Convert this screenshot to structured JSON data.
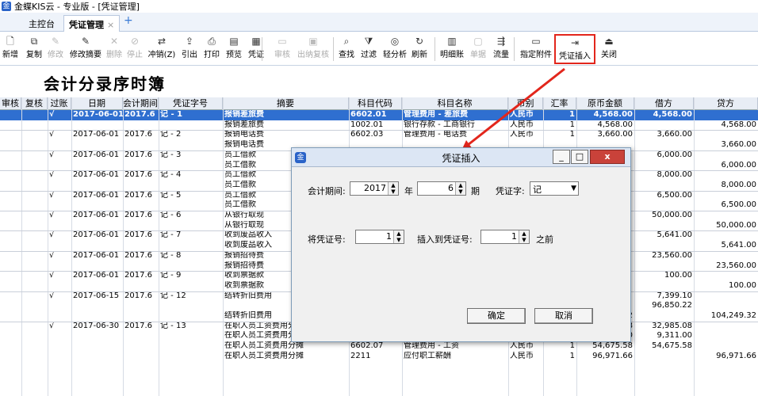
{
  "window": {
    "title": "金蝶KIS云 - 专业版 - [凭证管理]"
  },
  "tabs": [
    {
      "label": "主控台"
    },
    {
      "label": "凭证管理",
      "close": "×"
    }
  ],
  "tab_add": "+",
  "toolbar": {
    "buttons": [
      {
        "label": "新增",
        "icon": "new-icon"
      },
      {
        "label": "复制",
        "icon": "copy-icon"
      },
      {
        "label": "修改",
        "icon": "edit-icon",
        "disabled": true
      },
      {
        "label": "修改摘要",
        "icon": "edit-summary-icon"
      },
      {
        "label": "删除",
        "icon": "delete-icon",
        "disabled": true
      },
      {
        "label": "停止",
        "icon": "stop-icon",
        "disabled": true
      },
      {
        "label": "冲销(Z)",
        "icon": "reverse-icon"
      },
      {
        "label": "引出",
        "icon": "export-icon"
      },
      {
        "label": "打印",
        "icon": "print-icon"
      },
      {
        "label": "预览",
        "icon": "preview-icon"
      },
      {
        "label": "凭证",
        "icon": "voucher-icon"
      },
      {
        "label": "审核",
        "icon": "audit-icon",
        "disabled": true
      },
      {
        "label": "出纳复核",
        "icon": "cashier-review-icon",
        "disabled": true
      },
      {
        "label": "查找",
        "icon": "find-icon"
      },
      {
        "label": "过滤",
        "icon": "filter-icon"
      },
      {
        "label": "轻分析",
        "icon": "analysis-icon"
      },
      {
        "label": "刷新",
        "icon": "refresh-icon"
      },
      {
        "label": "明细账",
        "icon": "ledger-icon"
      },
      {
        "label": "单据",
        "icon": "document-icon",
        "disabled": true
      },
      {
        "label": "流量",
        "icon": "flow-icon"
      },
      {
        "label": "指定附件",
        "icon": "attachment-icon"
      },
      {
        "label": "凭证插入",
        "icon": "insert-icon"
      },
      {
        "label": "关闭",
        "icon": "close-icon"
      }
    ]
  },
  "report": {
    "title": "会计分录序时簿"
  },
  "grid": {
    "columns": [
      "审核",
      "复核",
      "过账",
      "日期",
      "会计期间",
      "凭证字号",
      "摘要",
      "科目代码",
      "科目名称",
      "币别",
      "汇率",
      "原币金额",
      "借方",
      "贷方"
    ],
    "rows": [
      {
        "sel": true,
        "posted": "√",
        "date": "2017-06-01",
        "period": "2017.6",
        "voucher": "记 - 1",
        "summary": "报销差旅费",
        "code": "6602.01",
        "account": "管理费用 - 差旅费",
        "currency": "人民币",
        "rate": "1",
        "amount": "4,568.00",
        "debit": "4,568.00",
        "credit": ""
      },
      {
        "summary": "报销差旅费",
        "code": "1002.01",
        "account": "银行存款 - 工商银行",
        "currency": "人民币",
        "rate": "1",
        "amount": "4,568.00",
        "debit": "",
        "credit": "4,568.00"
      },
      {
        "posted": "√",
        "date": "2017-06-01",
        "period": "2017.6",
        "voucher": "记 - 2",
        "summary": "报销电话费",
        "code": "6602.03",
        "account": "管理费用 - 电话费",
        "currency": "人民币",
        "rate": "1",
        "amount": "3,660.00",
        "debit": "3,660.00",
        "credit": ""
      },
      {
        "summary": "报销电话费",
        "credit": "3,660.00"
      },
      {
        "posted": "√",
        "date": "2017-06-01",
        "period": "2017.6",
        "voucher": "记 - 3",
        "summary": "员工借款",
        "debit": "6,000.00"
      },
      {
        "summary": "员工借款",
        "credit": "6,000.00"
      },
      {
        "posted": "√",
        "date": "2017-06-01",
        "period": "2017.6",
        "voucher": "记 - 4",
        "summary": "员工借款",
        "debit": "8,000.00"
      },
      {
        "summary": "员工借款",
        "credit": "8,000.00"
      },
      {
        "posted": "√",
        "date": "2017-06-01",
        "period": "2017.6",
        "voucher": "记 - 5",
        "summary": "员工借款",
        "debit": "6,500.00"
      },
      {
        "summary": "员工借款",
        "credit": "6,500.00"
      },
      {
        "posted": "√",
        "date": "2017-06-01",
        "period": "2017.6",
        "voucher": "记 - 6",
        "summary": "从银行取现",
        "debit": "50,000.00"
      },
      {
        "summary": "从银行取现",
        "credit": "50,000.00"
      },
      {
        "posted": "√",
        "date": "2017-06-01",
        "period": "2017.6",
        "voucher": "记 - 7",
        "summary": "收到废品收入",
        "debit": "5,641.00"
      },
      {
        "summary": "收到废品收入",
        "credit": "5,641.00"
      },
      {
        "posted": "√",
        "date": "2017-06-01",
        "period": "2017.6",
        "voucher": "记 - 8",
        "summary": "报销招待费",
        "debit": "23,560.00"
      },
      {
        "summary": "报销招待费",
        "credit": "23,560.00"
      },
      {
        "posted": "√",
        "date": "2017-06-01",
        "period": "2017.6",
        "voucher": "记 - 9",
        "summary": "收到票据款",
        "debit": "100.00"
      },
      {
        "summary": "收到票据款",
        "credit": "100.00"
      },
      {
        "posted": "√",
        "date": "2017-06-15",
        "period": "2017.6",
        "voucher": "记 - 12",
        "summary": "结转折旧费用",
        "debit": "7,399.10"
      },
      {
        "debit": "96,850.22"
      },
      {
        "summary": "结转折旧费用",
        "code": "1602",
        "account": "累计折旧",
        "currency": "人民币",
        "rate": "1",
        "amount": "104,249.32",
        "credit": "104,249.32"
      },
      {
        "posted": "√",
        "date": "2017-06-30",
        "period": "2017.6",
        "voucher": "记 - 13",
        "summary": "在职人员工资费用分摊",
        "code": "6401",
        "account": "主营业务成本",
        "currency": "人民币",
        "rate": "1",
        "amount": "32,985.08",
        "debit": "32,985.08"
      },
      {
        "summary": "在职人员工资费用分摊",
        "code": "6601",
        "account": "销售费用",
        "currency": "人民币",
        "rate": "1",
        "amount": "9,311.00",
        "debit": "9,311.00"
      },
      {
        "summary": "在职人员工资费用分摊",
        "code": "6602.07",
        "account": "管理费用 - 工资",
        "currency": "人民币",
        "rate": "1",
        "amount": "54,675.58",
        "debit": "54,675.58"
      },
      {
        "summary": "在职人员工资费用分摊",
        "code": "2211",
        "account": "应付职工薪酬",
        "currency": "人民币",
        "rate": "1",
        "amount": "96,971.66",
        "credit": "96,971.66"
      }
    ]
  },
  "dialog": {
    "title": "凭证插入",
    "period_label": "会计期间:",
    "year": "2017",
    "year_unit": "年",
    "period": "6",
    "period_unit": "期",
    "voucher_word_label": "凭证字:",
    "voucher_word": "记",
    "move_label": "将凭证号:",
    "move_value": "1",
    "insert_label": "插入到凭证号:",
    "insert_value": "1",
    "insert_suffix": "之前",
    "ok": "确定",
    "cancel": "取消",
    "btn_min": "_",
    "btn_max": "□",
    "btn_close": "x"
  },
  "colors": {
    "selected_row": "#2f6fd0",
    "highlight": "#e2261c"
  }
}
